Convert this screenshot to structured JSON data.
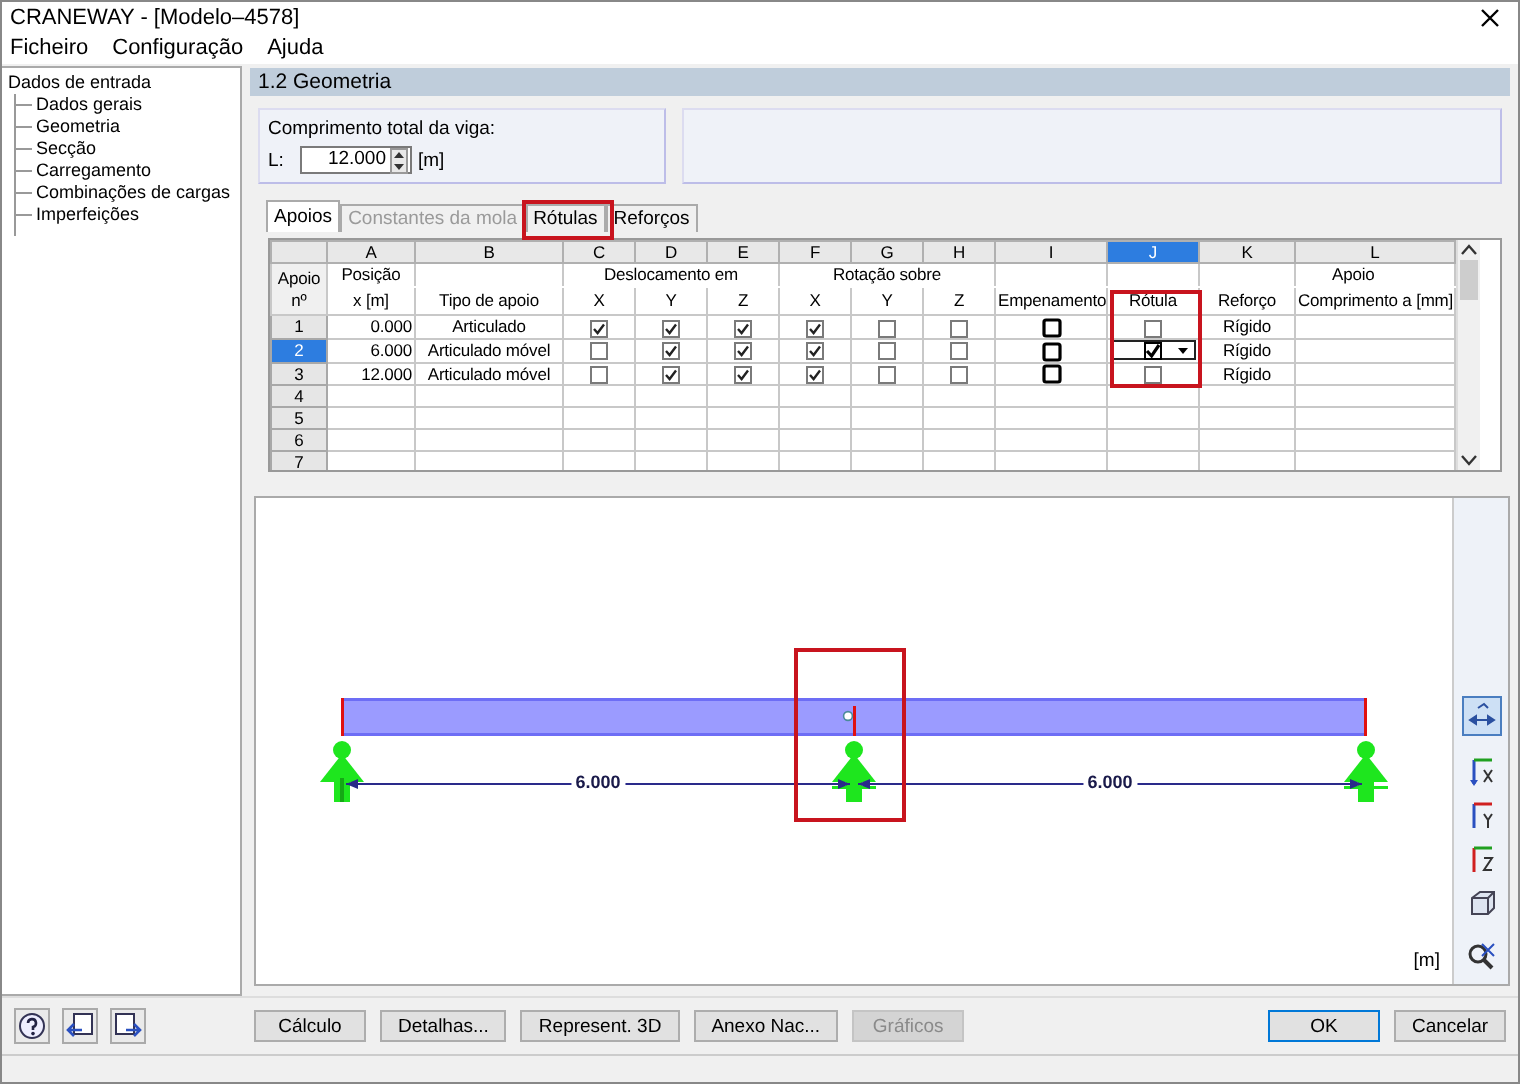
{
  "window": {
    "title": "CRANEWAY - [Modelo–4578]"
  },
  "menu": [
    "Ficheiro",
    "Configuração",
    "Ajuda"
  ],
  "tree": {
    "label": "Dados de entrada",
    "children": [
      {
        "label": "Dados gerais"
      },
      {
        "label": "Geometria"
      },
      {
        "label": "Secção"
      },
      {
        "label": "Carregamento"
      },
      {
        "label": "Combinações de cargas"
      },
      {
        "label": "Imperfeições"
      }
    ]
  },
  "panel": {
    "title": "1.2 Geometria"
  },
  "length": {
    "label": "Comprimento total da viga:",
    "prefix": "L:",
    "value": "12.000",
    "unit": "[m]"
  },
  "tabs": [
    {
      "label": "Apoios",
      "selected": true,
      "disabled": false,
      "highlighted": false
    },
    {
      "label": "Constantes da mola",
      "selected": false,
      "disabled": true,
      "highlighted": false
    },
    {
      "label": "Rótulas",
      "selected": false,
      "disabled": false,
      "highlighted": true
    },
    {
      "label": "Reforços",
      "selected": false,
      "disabled": false,
      "highlighted": false
    }
  ],
  "table": {
    "corner": "Apoio nº",
    "columns": [
      {
        "letter": "A",
        "heading": "Posição",
        "label": "x [m]",
        "selected": false,
        "highlighted": false
      },
      {
        "letter": "B",
        "label": "Tipo de apoio",
        "selected": false,
        "highlighted": false
      },
      {
        "heading": "Deslocamento em",
        "columns": [
          {
            "letter": "C",
            "label": "X",
            "selected": false,
            "highlighted": false
          },
          {
            "letter": "D",
            "label": "Y",
            "selected": false,
            "highlighted": false
          },
          {
            "letter": "E",
            "label": "Z",
            "selected": false,
            "highlighted": false
          }
        ]
      },
      {
        "heading": "Rotação sobre",
        "columns": [
          {
            "letter": "F",
            "label": "X",
            "selected": false,
            "highlighted": false
          },
          {
            "letter": "G",
            "label": "Y",
            "selected": false,
            "highlighted": false
          },
          {
            "letter": "H",
            "label": "Z",
            "selected": false,
            "highlighted": false
          }
        ]
      },
      {
        "letter": "I",
        "label": "Empenamento",
        "selected": false,
        "highlighted": false
      },
      {
        "letter": "J",
        "label": "Rótula",
        "selected": true,
        "highlighted": true
      },
      {
        "letter": "K",
        "label": "Reforço",
        "selected": false,
        "highlighted": false
      },
      {
        "letter": "L",
        "heading": "Apoio",
        "label": "Comprimento a [mm]",
        "selected": false,
        "highlighted": false
      }
    ],
    "rows": [
      {
        "number": "1",
        "selected": false,
        "cells": [
          {
            "kind": "number",
            "text": "0.000"
          },
          {
            "kind": "text",
            "text": "Articulado"
          },
          {
            "kind": "check",
            "checked": true
          },
          {
            "kind": "check",
            "checked": true
          },
          {
            "kind": "check",
            "checked": true
          },
          {
            "kind": "check",
            "checked": true
          },
          {
            "kind": "check",
            "checked": false
          },
          {
            "kind": "check",
            "checked": false
          },
          {
            "kind": "box",
            "checked": false
          },
          {
            "kind": "check",
            "checked": false
          },
          {
            "kind": "text",
            "text": "Rígido"
          }
        ]
      },
      {
        "number": "2",
        "selected": true,
        "cells": [
          {
            "kind": "number",
            "text": "6.000"
          },
          {
            "kind": "text",
            "text": "Articulado móvel"
          },
          {
            "kind": "check",
            "checked": false
          },
          {
            "kind": "check",
            "checked": true
          },
          {
            "kind": "check",
            "checked": true
          },
          {
            "kind": "check",
            "checked": true
          },
          {
            "kind": "check",
            "checked": false
          },
          {
            "kind": "check",
            "checked": false
          },
          {
            "kind": "box",
            "checked": false
          },
          {
            "kind": "dropdown-check",
            "checked": true
          },
          {
            "kind": "text",
            "text": "Rígido"
          }
        ]
      },
      {
        "number": "3",
        "selected": false,
        "cells": [
          {
            "kind": "number",
            "text": "12.000"
          },
          {
            "kind": "text",
            "text": "Articulado móvel"
          },
          {
            "kind": "check",
            "checked": false
          },
          {
            "kind": "check",
            "checked": true
          },
          {
            "kind": "check",
            "checked": true
          },
          {
            "kind": "check",
            "checked": true
          },
          {
            "kind": "check",
            "checked": false
          },
          {
            "kind": "check",
            "checked": false
          },
          {
            "kind": "box",
            "checked": false
          },
          {
            "kind": "check",
            "checked": false
          },
          {
            "kind": "text",
            "text": "Rígido"
          }
        ]
      },
      {
        "number": "4",
        "selected": false
      },
      {
        "number": "5",
        "selected": false
      },
      {
        "number": "6",
        "selected": false
      },
      {
        "number": "7",
        "selected": false
      }
    ]
  },
  "diagram": {
    "supports": [
      {
        "kind": "fixed"
      },
      {
        "kind": "movable"
      },
      {
        "kind": "movable"
      }
    ],
    "spans": [
      "6.000",
      "6.000"
    ],
    "hinge": {
      "highlighted": true
    },
    "unit": "[m]"
  },
  "view_tools": [
    {
      "kind": "dimension",
      "selected": true
    },
    {
      "kind": "x",
      "selected": false
    },
    {
      "kind": "y",
      "selected": false
    },
    {
      "kind": "z",
      "selected": false
    },
    {
      "kind": "iso",
      "selected": false
    },
    {
      "kind": "zoom",
      "selected": false
    }
  ],
  "footer_tools": [
    {
      "kind": "help"
    },
    {
      "kind": "import"
    },
    {
      "kind": "export"
    }
  ],
  "buttons": [
    {
      "label": "Cálculo",
      "disabled": false,
      "default": false
    },
    {
      "label": "Detalhas...",
      "disabled": false,
      "default": false
    },
    {
      "label": "Represent. 3D",
      "disabled": false,
      "default": false
    },
    {
      "label": "Anexo Nac...",
      "disabled": false,
      "default": false
    },
    {
      "label": "Gráficos",
      "disabled": true,
      "default": false
    }
  ],
  "dialog_buttons": [
    {
      "label": "OK",
      "disabled": false,
      "default": true
    },
    {
      "label": "Cancelar",
      "disabled": false,
      "default": false
    }
  ]
}
